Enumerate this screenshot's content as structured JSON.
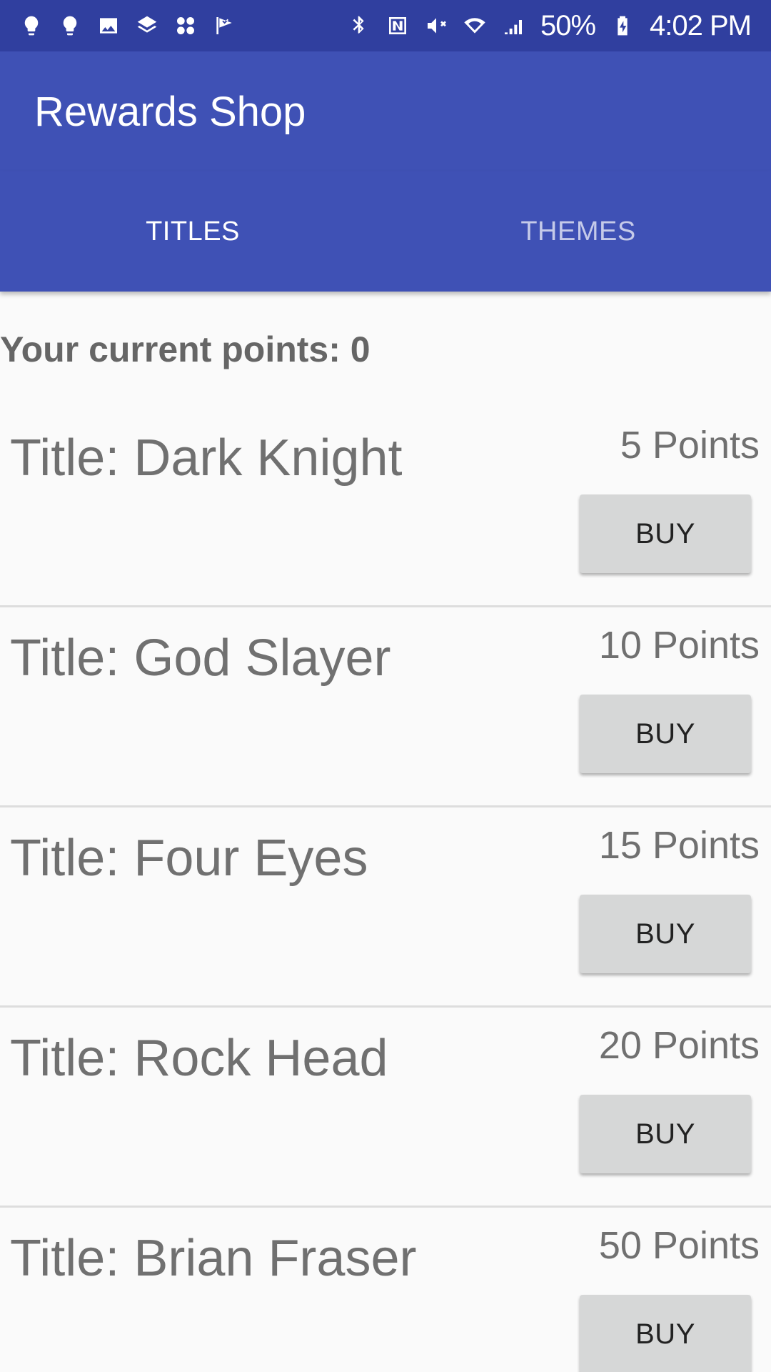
{
  "status_bar": {
    "left_icons": [
      "bulb-icon",
      "bulb-icon",
      "image-icon",
      "layers-icon",
      "apps-icon",
      "check-flag-icon"
    ],
    "right_icons": [
      "bluetooth-icon",
      "nfc-icon",
      "mute-icon",
      "wifi-icon",
      "signal-icon"
    ],
    "battery": "50%",
    "battery_icon": "battery-charging-icon",
    "time": "4:02 PM"
  },
  "app_bar": {
    "title": "Rewards Shop"
  },
  "tabs": [
    {
      "label": "TITLES",
      "active": true
    },
    {
      "label": "THEMES",
      "active": false
    }
  ],
  "points_text": "Your current points: 0",
  "items": [
    {
      "title": "Title: Dark Knight",
      "points": "5 Points",
      "button": "BUY"
    },
    {
      "title": "Title: God Slayer",
      "points": "10 Points",
      "button": "BUY"
    },
    {
      "title": "Title: Four Eyes",
      "points": "15 Points",
      "button": "BUY"
    },
    {
      "title": "Title: Rock Head",
      "points": "20 Points",
      "button": "BUY"
    },
    {
      "title": "Title: Brian Fraser",
      "points": "50 Points",
      "button": "BUY"
    }
  ],
  "colors": {
    "status_bar": "#303f9f",
    "primary": "#3f51b5",
    "active_tab_text": "#ffffff",
    "inactive_tab_text": "#c5cae9",
    "body_text": "#707070",
    "button_bg": "#d6d7d7"
  }
}
